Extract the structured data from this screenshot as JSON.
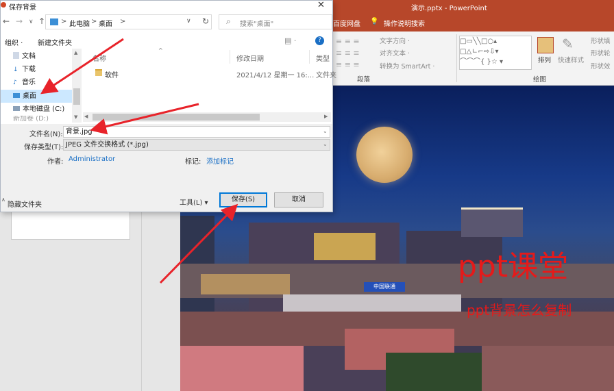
{
  "powerpoint": {
    "window_title": "演示.pptx  -  PowerPoint",
    "tabs": [
      "百度网盘",
      "操作说明搜索"
    ],
    "ribbon": {
      "text_direction": "文字方向 ·",
      "align_text": "对齐文本 ·",
      "convert_smartart": "转换为 SmartArt ·",
      "group_paragraph": "段落",
      "arrange": "排列",
      "quick_styles": "快速样式",
      "shape_fill": "形状填",
      "shape_outline": "形状轮",
      "shape_effects": "形状效",
      "group_drawing": "绘图"
    },
    "slide": {
      "title": "ppt课堂",
      "subtitle": "ppt背景怎么复制",
      "building_sign": "中国联通"
    }
  },
  "dialog": {
    "title": "保存背景",
    "close": "✕",
    "nav": {
      "back": "←",
      "forward": "→",
      "recent": "∨",
      "up": "↑"
    },
    "breadcrumb": [
      "此电脑",
      "桌面"
    ],
    "breadcrumb_sep": ">",
    "refresh": "↻",
    "search_placeholder": "搜索\"桌面\"",
    "toolbar": {
      "organize": "组织 ·",
      "new_folder": "新建文件夹",
      "help": "?"
    },
    "sidebar": [
      {
        "label": "文档"
      },
      {
        "label": "下载"
      },
      {
        "label": "音乐"
      },
      {
        "label": "桌面",
        "selected": true
      },
      {
        "label": "本地磁盘 (C:)"
      },
      {
        "label": "新加卷 (D:)"
      }
    ],
    "columns": {
      "name": "名称",
      "modified": "修改日期",
      "type": "类型"
    },
    "files": [
      {
        "name": "软件",
        "modified": "2021/4/12 星期一 16:...",
        "type": "文件夹"
      }
    ],
    "form": {
      "filename_label": "文件名(N):",
      "filename_value": "背景.jpg",
      "filetype_label": "保存类型(T):",
      "filetype_value": "JPEG 文件交换格式 (*.jpg)",
      "author_label": "作者:",
      "author_value": "Administrator",
      "tags_label": "标记:",
      "tags_value": "添加标记",
      "hide_folders": "隐藏文件夹",
      "tools": "工具(L)  ▾",
      "save": "保存(S)",
      "cancel": "取消"
    }
  }
}
